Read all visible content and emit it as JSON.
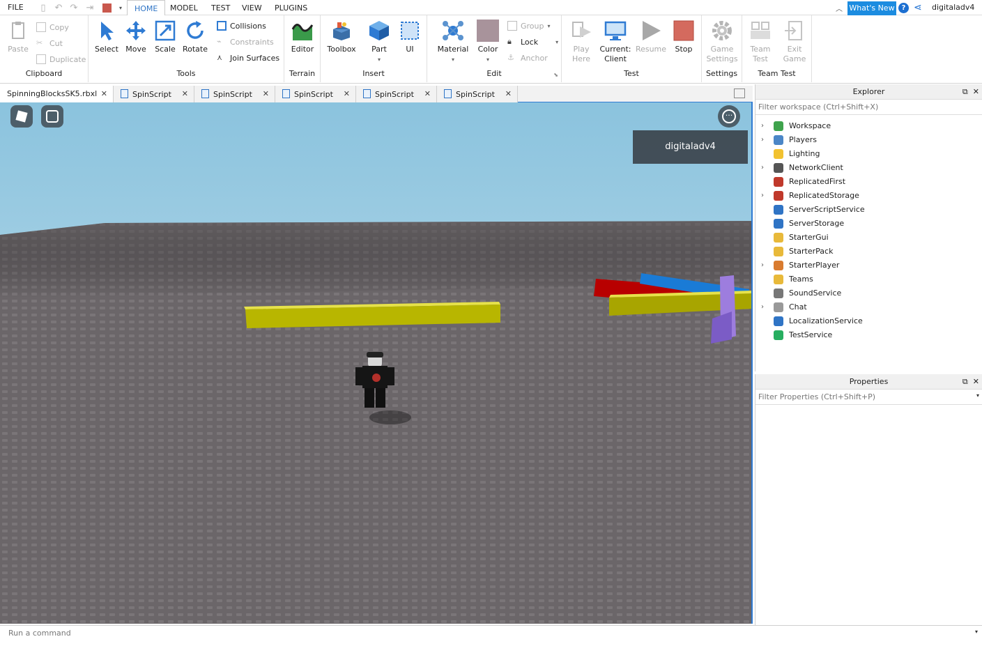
{
  "menu": {
    "file": "FILE",
    "tabs": [
      "HOME",
      "MODEL",
      "TEST",
      "VIEW",
      "PLUGINS"
    ],
    "active_tab": "HOME",
    "whats_new": "What's New",
    "username": "digitaladv4"
  },
  "ribbon": {
    "clipboard": {
      "label": "Clipboard",
      "paste": "Paste",
      "copy": "Copy",
      "cut": "Cut",
      "duplicate": "Duplicate"
    },
    "tools": {
      "label": "Tools",
      "select": "Select",
      "move": "Move",
      "scale": "Scale",
      "rotate": "Rotate",
      "collisions": "Collisions",
      "constraints": "Constraints",
      "join_surfaces": "Join Surfaces"
    },
    "terrain": {
      "label": "Terrain",
      "editor": "Editor"
    },
    "insert": {
      "label": "Insert",
      "toolbox": "Toolbox",
      "part": "Part",
      "ui": "UI"
    },
    "edit": {
      "label": "Edit",
      "material": "Material",
      "color": "Color",
      "group": "Group",
      "lock": "Lock",
      "anchor": "Anchor"
    },
    "test": {
      "label": "Test",
      "play_here_1": "Play",
      "play_here_2": "Here",
      "current_client_1": "Current:",
      "current_client_2": "Client",
      "resume": "Resume",
      "stop": "Stop"
    },
    "settings": {
      "label": "Settings",
      "game_settings_1": "Game",
      "game_settings_2": "Settings"
    },
    "team_test": {
      "label": "Team Test",
      "team_test_1": "Team",
      "team_test_2": "Test",
      "exit_game_1": "Exit",
      "exit_game_2": "Game"
    }
  },
  "doc_tabs": [
    "SpinningBlocksSK5.rbxl",
    "SpinScript",
    "SpinScript",
    "SpinScript",
    "SpinScript",
    "SpinScript"
  ],
  "viewport": {
    "player_name": "digitaladv4"
  },
  "explorer": {
    "title": "Explorer",
    "filter_placeholder": "Filter workspace (Ctrl+Shift+X)",
    "items": [
      {
        "label": "Workspace",
        "expandable": true,
        "color": "#3fa34d"
      },
      {
        "label": "Players",
        "expandable": true,
        "color": "#4b86c7"
      },
      {
        "label": "Lighting",
        "expandable": false,
        "color": "#f2c230"
      },
      {
        "label": "NetworkClient",
        "expandable": true,
        "color": "#555555"
      },
      {
        "label": "ReplicatedFirst",
        "expandable": false,
        "color": "#c0392b"
      },
      {
        "label": "ReplicatedStorage",
        "expandable": true,
        "color": "#c0392b"
      },
      {
        "label": "ServerScriptService",
        "expandable": false,
        "color": "#2f74c5"
      },
      {
        "label": "ServerStorage",
        "expandable": false,
        "color": "#2f74c5"
      },
      {
        "label": "StarterGui",
        "expandable": false,
        "color": "#e8b93a"
      },
      {
        "label": "StarterPack",
        "expandable": false,
        "color": "#e8b93a"
      },
      {
        "label": "StarterPlayer",
        "expandable": true,
        "color": "#d97b2f"
      },
      {
        "label": "Teams",
        "expandable": false,
        "color": "#e8b93a"
      },
      {
        "label": "SoundService",
        "expandable": false,
        "color": "#777777"
      },
      {
        "label": "Chat",
        "expandable": true,
        "color": "#999999"
      },
      {
        "label": "LocalizationService",
        "expandable": false,
        "color": "#2f74c5"
      },
      {
        "label": "TestService",
        "expandable": false,
        "color": "#27ae60"
      }
    ]
  },
  "properties": {
    "title": "Properties",
    "filter_placeholder": "Filter Properties (Ctrl+Shift+P)"
  },
  "command_bar": {
    "placeholder": "Run a command"
  }
}
